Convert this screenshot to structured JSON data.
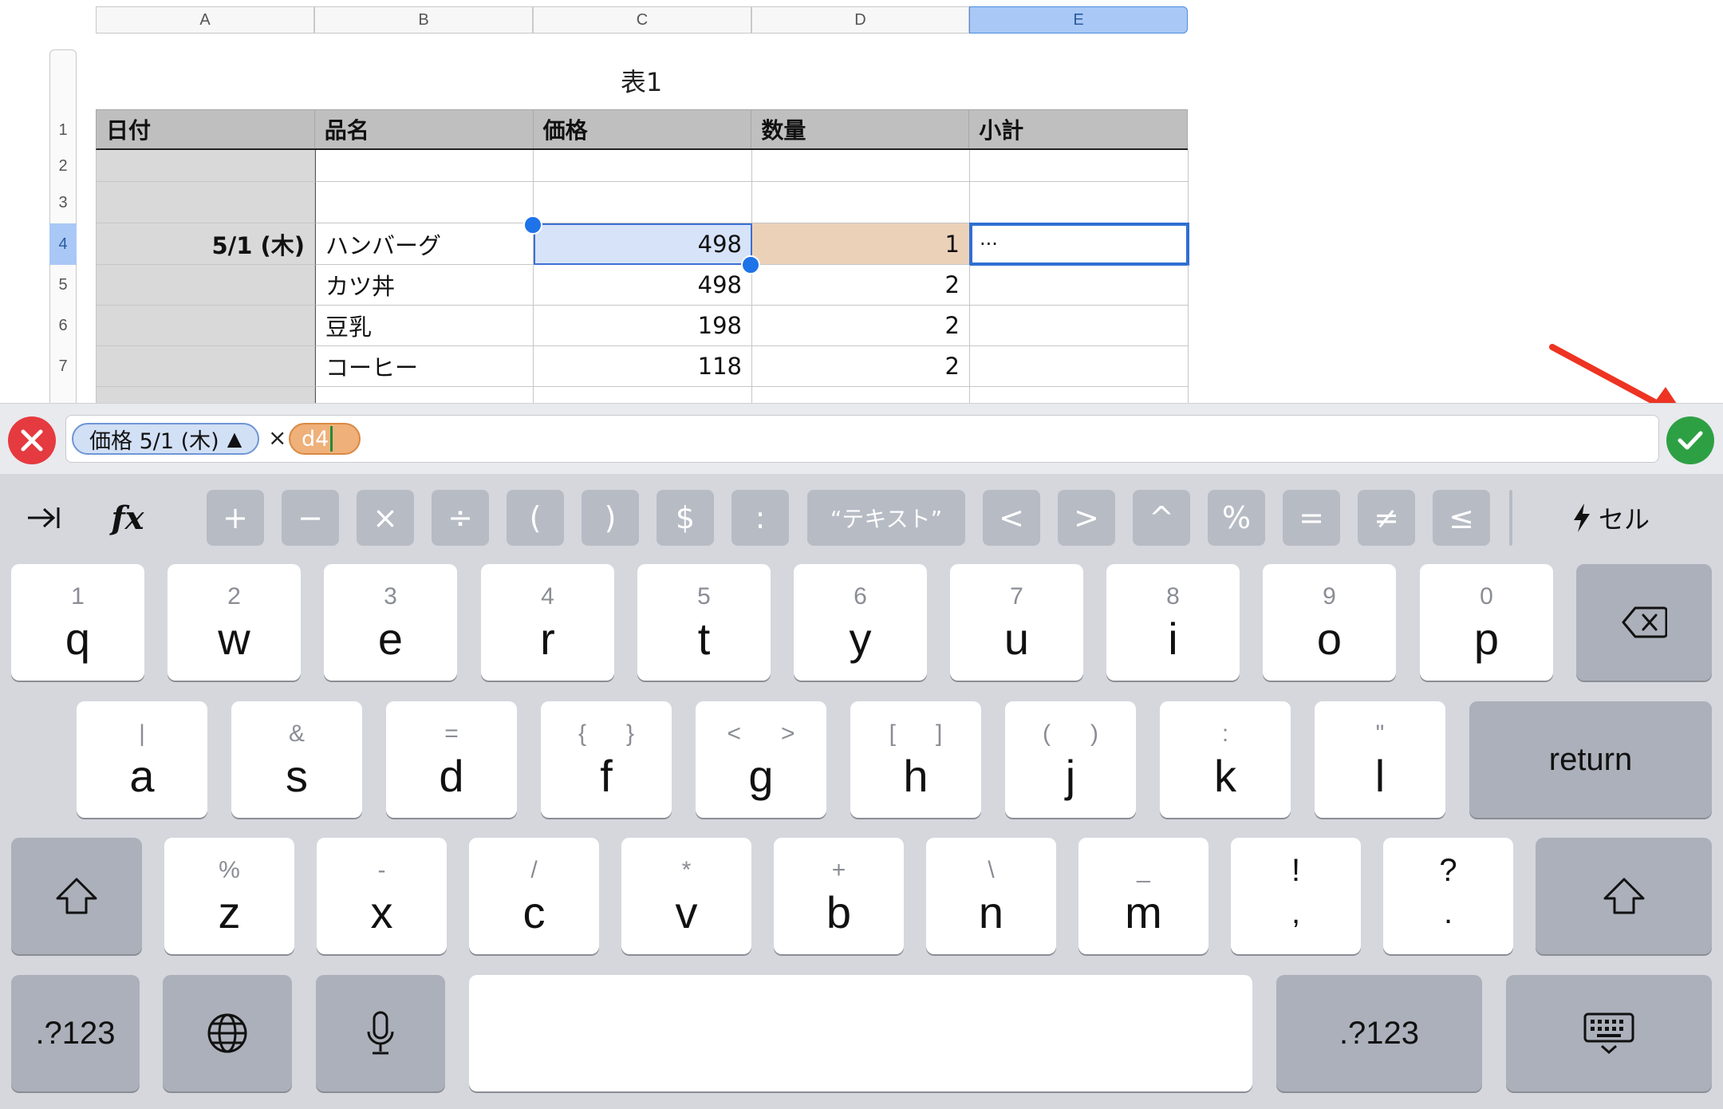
{
  "columns": [
    "A",
    "B",
    "C",
    "D",
    "E"
  ],
  "selected_column": "E",
  "rows": [
    "1",
    "2",
    "3",
    "4",
    "5",
    "6",
    "7"
  ],
  "selected_row": "4",
  "table_title": "表1",
  "headers": [
    "日付",
    "品名",
    "価格",
    "数量",
    "小計"
  ],
  "table_rows": [
    {
      "date": "",
      "item": "",
      "price": "",
      "qty": "",
      "subtotal": ""
    },
    {
      "date": "",
      "item": "",
      "price": "",
      "qty": "",
      "subtotal": ""
    },
    {
      "date": "5/1 (木)",
      "item": "ハンバーグ",
      "price": "498",
      "qty": "1",
      "subtotal": "···"
    },
    {
      "date": "",
      "item": "カツ丼",
      "price": "498",
      "qty": "2",
      "subtotal": ""
    },
    {
      "date": "",
      "item": "豆乳",
      "price": "198",
      "qty": "2",
      "subtotal": ""
    },
    {
      "date": "",
      "item": "コーヒー",
      "price": "118",
      "qty": "2",
      "subtotal": ""
    }
  ],
  "formula": {
    "token1_label": "価格 5/1 (木)",
    "token1_arrow": "▲",
    "operator": "×",
    "token2_label": "d4"
  },
  "formula_keys": [
    "+",
    "−",
    "×",
    "÷",
    "(",
    ")",
    "$",
    ":",
    "“テキスト”",
    "<",
    ">",
    "^",
    "%",
    "=",
    "≠",
    "≤"
  ],
  "formula_row_icons": {
    "tab": "tab-icon",
    "fx": "fx-icon",
    "cell_icon": "lightning-icon"
  },
  "fx_label": "fx",
  "cell_label": "セル",
  "keyboard": {
    "row1": [
      {
        "sec": "1",
        "pri": "q"
      },
      {
        "sec": "2",
        "pri": "w"
      },
      {
        "sec": "3",
        "pri": "e"
      },
      {
        "sec": "4",
        "pri": "r"
      },
      {
        "sec": "5",
        "pri": "t"
      },
      {
        "sec": "6",
        "pri": "y"
      },
      {
        "sec": "7",
        "pri": "u"
      },
      {
        "sec": "8",
        "pri": "i"
      },
      {
        "sec": "9",
        "pri": "o"
      },
      {
        "sec": "0",
        "pri": "p"
      }
    ],
    "row2": [
      {
        "sec": "|",
        "pri": "a"
      },
      {
        "sec": "&",
        "pri": "s"
      },
      {
        "sec": "=",
        "pri": "d"
      },
      {
        "sec": "{      }",
        "pri": "f"
      },
      {
        "sec": "<      >",
        "pri": "g"
      },
      {
        "sec": "[      ]",
        "pri": "h"
      },
      {
        "sec": "(      )",
        "pri": "j"
      },
      {
        "sec": ":",
        "pri": "k"
      },
      {
        "sec": "\"",
        "pri": "l"
      }
    ],
    "row3": [
      {
        "sec": "%",
        "pri": "z"
      },
      {
        "sec": "-",
        "pri": "x"
      },
      {
        "sec": "/",
        "pri": "c"
      },
      {
        "sec": "*",
        "pri": "v"
      },
      {
        "sec": "+",
        "pri": "b"
      },
      {
        "sec": "\\",
        "pri": "n"
      },
      {
        "sec": "_",
        "pri": "m"
      },
      {
        "sec": "!",
        "pri": ","
      },
      {
        "sec": "?",
        "pri": "."
      }
    ],
    "return_label": "return",
    "numbers_label": ".?123",
    "icons": {
      "delete": "delete-icon",
      "shift": "shift-icon",
      "globe": "globe-icon",
      "mic": "microphone-icon",
      "hide": "keyboard-hide-icon"
    }
  },
  "colors": {
    "accent_blue": "#1e73e8",
    "cancel_red": "#e53a3f",
    "confirm_green": "#2ea044",
    "token_orange": "#efb07a",
    "annotation_arrow": "#ee3322"
  }
}
